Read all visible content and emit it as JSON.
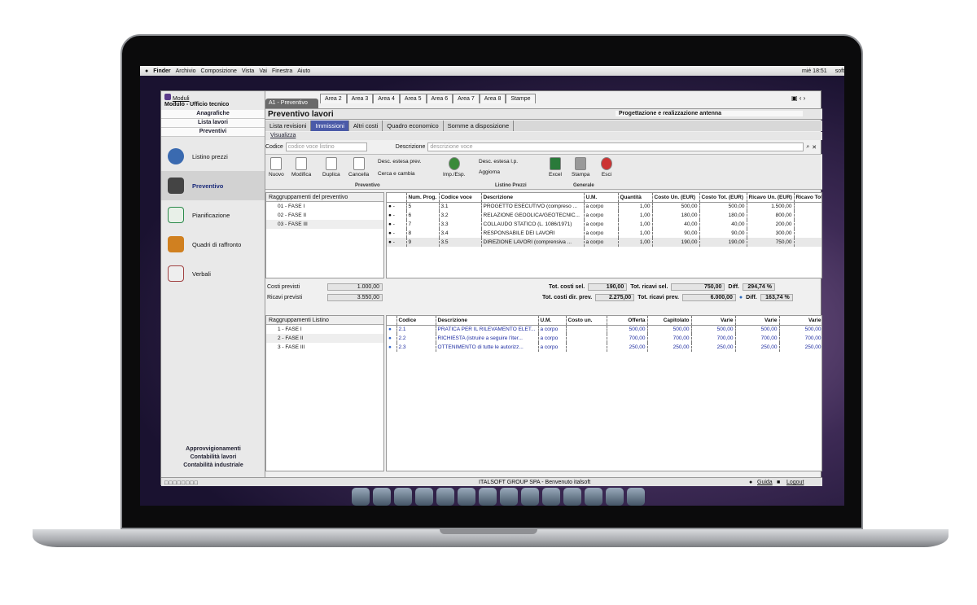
{
  "menubar": {
    "apple": "",
    "app": "Finder",
    "items": [
      "Archivio",
      "Composizione",
      "Vista",
      "Vai",
      "Finestra",
      "Aiuto"
    ],
    "clock": "mié 18:51",
    "user": "soft"
  },
  "sidebar": {
    "moduli": "Moduli",
    "modulo": "Modulo - Ufficio tecnico",
    "links": [
      "Anagrafiche",
      "Lista lavori",
      "Preventivi"
    ],
    "items": [
      {
        "label": "Listino prezzi",
        "icon": "euro-icon",
        "color": "#3a6ab0"
      },
      {
        "label": "Preventivo",
        "icon": "document-icon",
        "color": "#444"
      },
      {
        "label": "Pianificazione",
        "icon": "chart-icon",
        "color": "#2a8a4a"
      },
      {
        "label": "Quadri di raffronto",
        "icon": "cubes-icon",
        "color": "#d08020"
      },
      {
        "label": "Verbali",
        "icon": "pencil-icon",
        "color": "#a04040"
      }
    ],
    "bottom": [
      "Approvvigionamenti",
      "Contabilità lavori",
      "Contabilità industriale"
    ]
  },
  "areas": [
    "Area 2",
    "Area 3",
    "Area 4",
    "Area 5",
    "Area 6",
    "Area 7",
    "Area 8",
    "Stampe"
  ],
  "active_area": "A1 - Preventivo",
  "title": "Preventivo lavori",
  "project": "Progettazione e realizzazione antenna",
  "subtabs": [
    "Lista revisioni",
    "Immissioni",
    "Altri costi",
    "Quadro economico",
    "Somme a disposizione"
  ],
  "visualizza": "Visualizza",
  "search": {
    "codice_label": "Codice",
    "codice_ph": "codice voce listino",
    "desc_label": "Descrizione",
    "desc_ph": "descrizione voce"
  },
  "toolbar": {
    "nuovo": "Nuovo",
    "modifica": "Modifica",
    "duplica": "Duplica",
    "cancella": "Cancella",
    "desc_prev": "Desc. estesa prev.",
    "cerca": "Cerca e cambia",
    "imp": "Imp./Esp.",
    "grp_prev": "Preventivo",
    "desc_lp": "Desc. estesa l.p.",
    "aggiorna": "Aggiorna",
    "grp_lp": "Listino Prezzi",
    "excel": "Excel",
    "stampa": "Stampa",
    "esci": "Esci",
    "grp_gen": "Generale"
  },
  "tree1": {
    "header": "Raggruppamenti del preventivo",
    "items": [
      "01 - FASE I",
      "02 - FASE II",
      "03 - FASE III"
    ]
  },
  "grid1": {
    "cols": [
      "Num. Prog.",
      "Codice voce",
      "Descrizione",
      "U.M.",
      "Quantità",
      "Costo Un. (EUR)",
      "Costo Tot. (EUR)",
      "Ricavo Un. (EUR)",
      "Ricavo Tot"
    ],
    "rows": [
      [
        "5",
        "3.1",
        "PROGETTO ESECUTIVO (compreso ...",
        "a corpo",
        "1,00",
        "500,00",
        "500,00",
        "1.500,00"
      ],
      [
        "6",
        "3.2",
        "RELAZIONE GEOOLICA/GEOTECNIC...",
        "a corpo",
        "1,00",
        "180,00",
        "180,00",
        "800,00"
      ],
      [
        "7",
        "3.3",
        "COLLAUDO STATICO (L. 1086/1971)",
        "a corpo",
        "1,00",
        "40,00",
        "40,00",
        "200,00"
      ],
      [
        "8",
        "3.4",
        "RESPONSABILE DEI LAVORI",
        "a corpo",
        "1,00",
        "90,00",
        "90,00",
        "300,00"
      ],
      [
        "9",
        "3.5",
        "DIREZIONE LAVORI (comprensiva ...",
        "a corpo",
        "1,00",
        "190,00",
        "190,00",
        "750,00"
      ]
    ]
  },
  "totals": {
    "costi_prev_label": "Costi previsti",
    "costi_prev": "1.000,00",
    "ricavi_prev_label": "Ricavi previsti",
    "ricavi_prev": "3.550,00",
    "tot_costi_sel_label": "Tot. costi sel.",
    "tot_costi_sel": "190,00",
    "tot_ricavi_sel_label": "Tot. ricavi sel.",
    "tot_ricavi_sel": "750,00",
    "diff_label": "Diff.",
    "diff1": "294,74 %",
    "tot_costi_dir_label": "Tot. costi dir. prev.",
    "tot_costi_dir": "2.275,00",
    "tot_ricavi_prev_label": "Tot. ricavi prev.",
    "tot_ricavi_prev": "6.000,00",
    "diff2": "163,74 %"
  },
  "tree2": {
    "header": "Raggruppamenti Listino",
    "items": [
      "1 - FASE I",
      "2 - FASE II",
      "3 - FASE III"
    ]
  },
  "grid2": {
    "cols": [
      "Codice",
      "Descrizione",
      "U.M.",
      "Costo un.",
      "Offerta",
      "Capitolato",
      "Varie",
      "Varie",
      "Varie"
    ],
    "rows": [
      [
        "2.1",
        "PRATICA PER IL RILEVAMENTO ELET...",
        "a corpo",
        "",
        "500,00",
        "500,00",
        "500,00",
        "500,00",
        "500,00"
      ],
      [
        "2.2",
        "RICHIESTA (istruire a seguire l'iter...",
        "a corpo",
        "",
        "700,00",
        "700,00",
        "700,00",
        "700,00",
        "700,00"
      ],
      [
        "2.3",
        "OTTENIMENTO di tutte le autorizz...",
        "a corpo",
        "",
        "250,00",
        "250,00",
        "250,00",
        "250,00",
        "250,00"
      ]
    ]
  },
  "status": {
    "text": "ITALSOFT GROUP SPA - Benvenuto italsoft",
    "guida": "Guida",
    "logout": "Logout"
  }
}
